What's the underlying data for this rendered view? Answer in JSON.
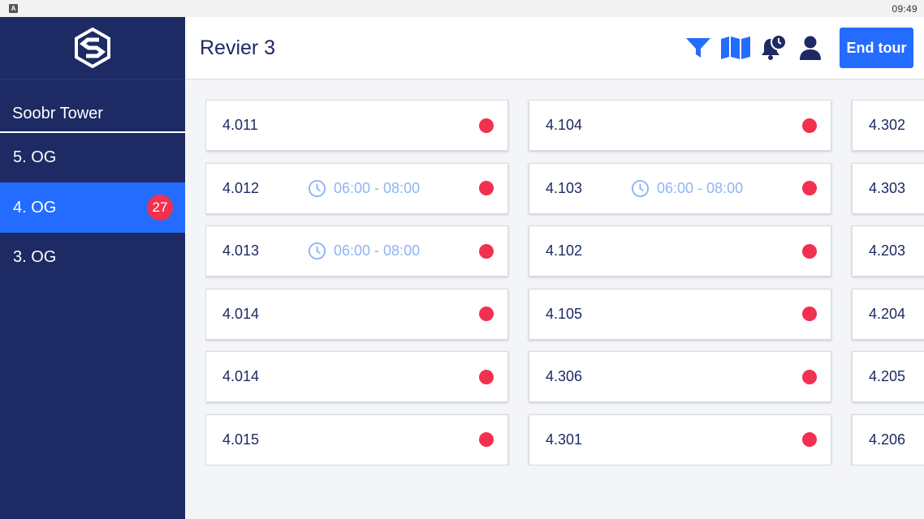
{
  "status": {
    "time": "09:49",
    "app_icon": "A"
  },
  "sidebar": {
    "logo": "soobr-logo-icon",
    "building": "Soobr Tower",
    "floors": [
      {
        "label": "5. OG",
        "badge": "",
        "active": false
      },
      {
        "label": "4. OG",
        "badge": "27",
        "active": true
      },
      {
        "label": "3. OG",
        "badge": "",
        "active": false
      }
    ]
  },
  "header": {
    "title": "Revier 3",
    "icons": [
      "filter-icon",
      "map-icon",
      "bell-clock-icon",
      "user-icon"
    ],
    "end_tour_label": "End tour"
  },
  "colors": {
    "sidebar": "#1d2a63",
    "accent": "#246bff",
    "alert": "#f2304f",
    "time_text": "#8fb4f4"
  },
  "rooms": {
    "columns": [
      [
        {
          "number": "4.011",
          "time": ""
        },
        {
          "number": "4.012",
          "time": "06:00 - 08:00"
        },
        {
          "number": "4.013",
          "time": "06:00 - 08:00"
        },
        {
          "number": "4.014",
          "time": ""
        },
        {
          "number": "4.014",
          "time": ""
        },
        {
          "number": "4.015",
          "time": ""
        }
      ],
      [
        {
          "number": "4.104",
          "time": ""
        },
        {
          "number": "4.103",
          "time": "06:00 - 08:00"
        },
        {
          "number": "4.102",
          "time": ""
        },
        {
          "number": "4.105",
          "time": ""
        },
        {
          "number": "4.306",
          "time": ""
        },
        {
          "number": "4.301",
          "time": ""
        }
      ],
      [
        {
          "number": "4.302",
          "time": ""
        },
        {
          "number": "4.303",
          "time": ""
        },
        {
          "number": "4.203",
          "time": ""
        },
        {
          "number": "4.204",
          "time": ""
        },
        {
          "number": "4.205",
          "time": ""
        },
        {
          "number": "4.206",
          "time": ""
        }
      ]
    ]
  }
}
